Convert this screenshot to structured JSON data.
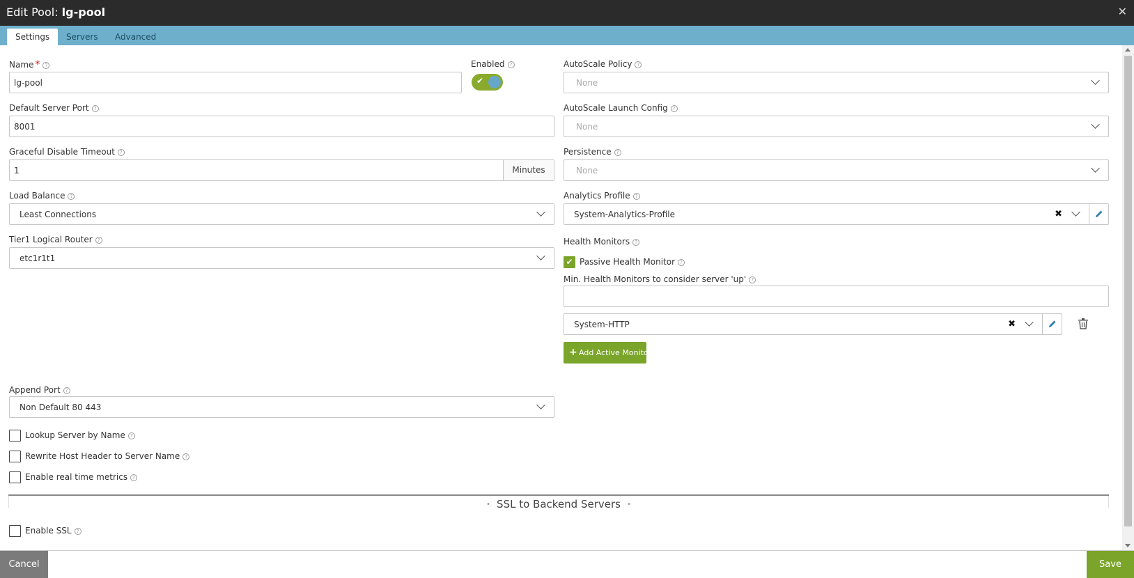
{
  "dialog": {
    "title_prefix": "Edit Pool:",
    "title_name": "lg-pool",
    "close_label": "✕"
  },
  "tabs": [
    {
      "label": "Settings",
      "active": true
    },
    {
      "label": "Servers",
      "active": false
    },
    {
      "label": "Advanced",
      "active": false
    }
  ],
  "left": {
    "name": {
      "label": "Name",
      "required_mark": "*",
      "value": "lg-pool"
    },
    "enabled": {
      "label": "Enabled",
      "on": true
    },
    "default_server_port": {
      "label": "Default Server Port",
      "value": "8001"
    },
    "graceful_disable_timeout": {
      "label": "Graceful Disable Timeout",
      "value": "1",
      "unit": "Minutes"
    },
    "load_balance": {
      "label": "Load Balance",
      "value": "Least Connections"
    },
    "tier1_router": {
      "label": "Tier1 Logical Router",
      "value": "etc1r1t1"
    },
    "append_port": {
      "label": "Append Port",
      "value": "Non Default 80 443"
    },
    "checkboxes": [
      {
        "label": "Lookup Server by Name",
        "checked": false
      },
      {
        "label": "Rewrite Host Header to Server Name",
        "checked": false
      },
      {
        "label": "Enable real time metrics",
        "checked": false
      }
    ]
  },
  "right": {
    "autoscale_policy": {
      "label": "AutoScale Policy",
      "placeholder": "None"
    },
    "autoscale_launch_config": {
      "label": "AutoScale Launch Config",
      "placeholder": "None"
    },
    "persistence": {
      "label": "Persistence",
      "placeholder": "None"
    },
    "analytics_profile": {
      "label": "Analytics Profile",
      "value": "System-Analytics-Profile"
    },
    "health_monitors": {
      "label": "Health Monitors",
      "passive": {
        "label": "Passive Health Monitor",
        "checked": true
      },
      "min_label": "Min. Health Monitors to consider server 'up'",
      "min_value": "",
      "active_monitor": "System-HTTP",
      "add_button": "Add Active Monitor"
    }
  },
  "ssl": {
    "section_title": "SSL to Backend Servers",
    "enable_ssl": {
      "label": "Enable SSL",
      "checked": false
    }
  },
  "footer": {
    "cancel": "Cancel",
    "save": "Save"
  },
  "colors": {
    "accent_green": "#7aa52a",
    "tab_bar": "#6eb0cc",
    "title_bar": "#2b2b2b"
  }
}
